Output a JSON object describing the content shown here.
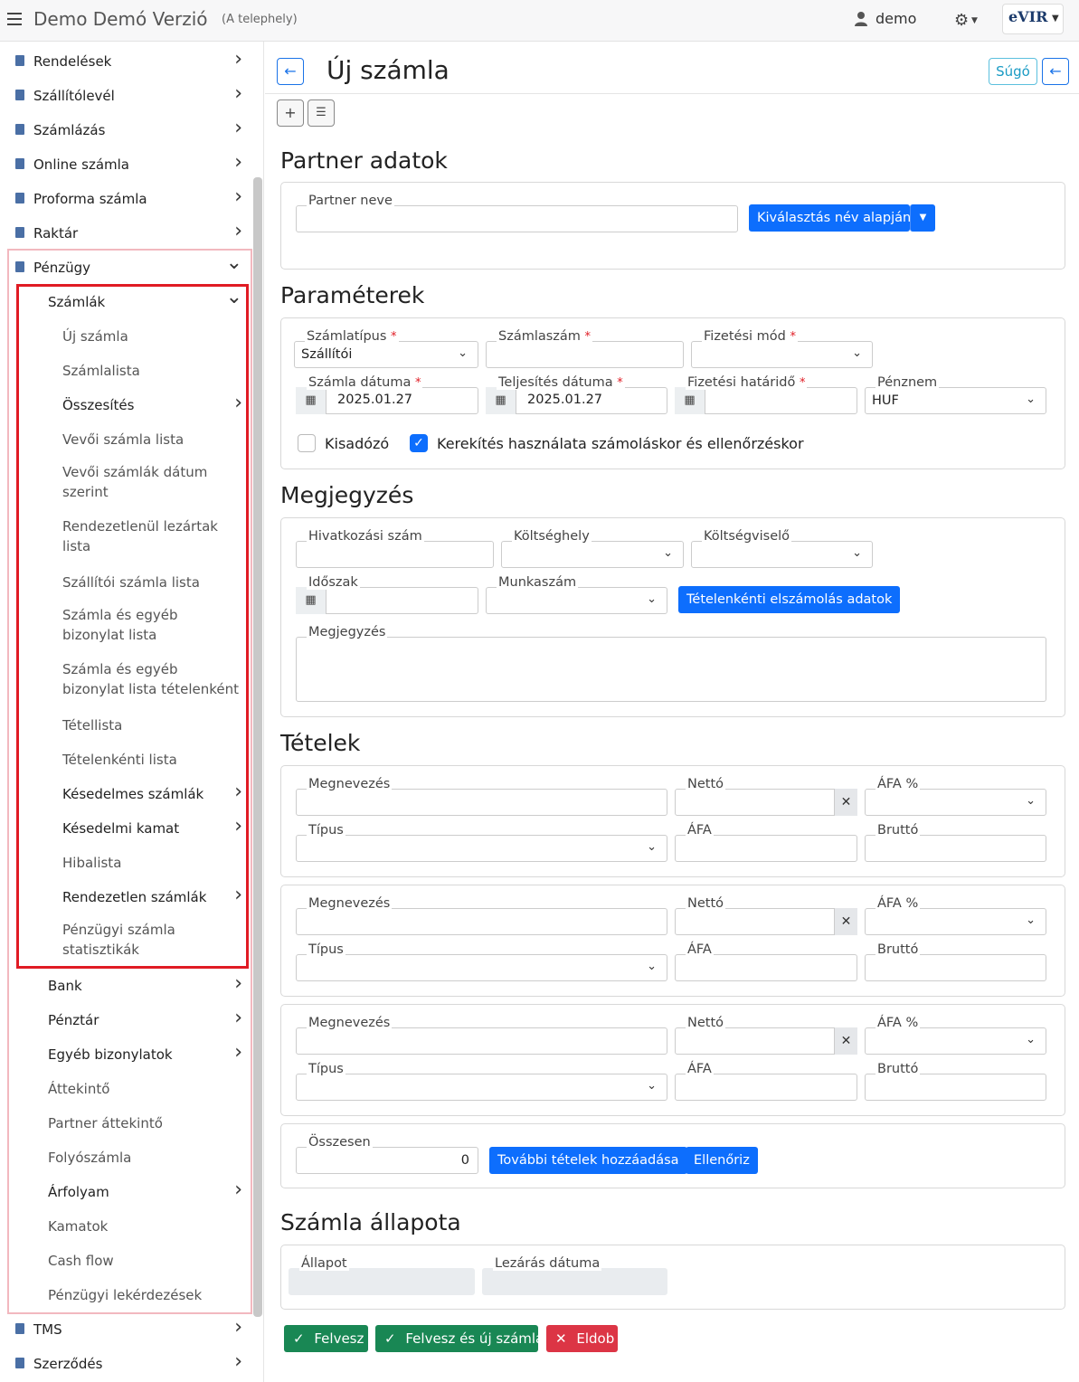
{
  "header": {
    "app_title": "Demo Demó Verzió",
    "app_subtitle": "(A telephely)",
    "user_name": "demo",
    "logo_text": "eVIR"
  },
  "sidebar": {
    "top_items": [
      {
        "label": "Rendelések",
        "icon": "document-icon"
      },
      {
        "label": "Szállítólevél",
        "icon": "clipboard-icon"
      },
      {
        "label": "Számlázás",
        "icon": "invoice-icon"
      },
      {
        "label": "Online számla",
        "icon": "globe-icon"
      },
      {
        "label": "Proforma számla",
        "icon": "note-icon"
      },
      {
        "label": "Raktár",
        "icon": "warehouse-icon"
      }
    ],
    "penzugy": "Pénzügy",
    "szamlak": "Számlák",
    "szamlak_children": [
      "Új számla",
      "Számlalista",
      "Összesítés",
      "Vevői számla lista",
      "Vevői számlák dátum szerint",
      "Rendezetlenül lezártak lista",
      "Szállítói számla lista",
      "Számla és egyéb bizonylat lista",
      "Számla és egyéb bizonylat lista tételenként",
      "Tétellista",
      "Tételenkénti lista",
      "Késedelmes számlák",
      "Késedelmi kamat",
      "Hibalista",
      "Rendezetlen számlák",
      "Pénzügyi számla statisztikák"
    ],
    "penzugy_children": [
      "Bank",
      "Pénztár",
      "Egyéb bizonylatok",
      "Áttekintő",
      "Partner áttekintő",
      "Folyószámla",
      "Árfolyam",
      "Kamatok",
      "Cash flow",
      "Pénzügyi lekérdezések"
    ],
    "bottom_items": [
      {
        "label": "TMS",
        "icon": "pin-icon"
      },
      {
        "label": "Szerződés",
        "icon": "contract-icon"
      }
    ]
  },
  "page": {
    "title": "Új számla",
    "help_label": "Súgó"
  },
  "partner": {
    "section_title": "Partner adatok",
    "name_label": "Partner neve",
    "select_button": "Kiválasztás név alapján"
  },
  "params": {
    "section_title": "Paraméterek",
    "type_label": "Számlatípus",
    "type_value": "Szállítói",
    "number_label": "Számlaszám",
    "payment_label": "Fizetési mód",
    "date_label": "Számla dátuma",
    "date_value": "2025.01.27",
    "fulfil_label": "Teljesítés dátuma",
    "fulfil_value": "2025.01.27",
    "due_label": "Fizetési határidő",
    "currency_label": "Pénznem",
    "currency_value": "HUF",
    "small_taxpayer_label": "Kisadózó",
    "rounding_label": "Kerekítés használata számoláskor és ellenőrzéskor"
  },
  "note": {
    "section_title": "Megjegyzés",
    "ref_label": "Hivatkozási szám",
    "cost_center_label": "Költséghely",
    "cost_bearer_label": "Költségviselő",
    "period_label": "Időszak",
    "job_label": "Munkaszám",
    "item_settlement_button": "Tételenkénti elszámolás adatok",
    "note_label": "Megjegyzés"
  },
  "items": {
    "section_title": "Tételek",
    "name_label": "Megnevezés",
    "net_label": "Nettó",
    "vat_pct_label": "ÁFA %",
    "type_label": "Típus",
    "vat_label": "ÁFA",
    "gross_label": "Bruttó",
    "total_label": "Összesen",
    "total_value": "0",
    "add_more_button": "További tételek hozzáadása",
    "check_button": "Ellenőriz"
  },
  "status": {
    "section_title": "Számla állapota",
    "state_label": "Állapot",
    "close_date_label": "Lezárás dátuma"
  },
  "actions": {
    "save": "Felvesz",
    "save_new": "Felvesz és új számla",
    "discard": "Eldob"
  }
}
